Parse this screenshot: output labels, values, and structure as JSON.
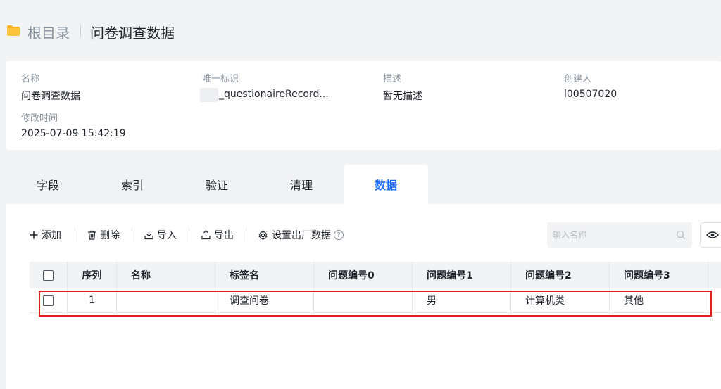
{
  "breadcrumb": {
    "root": "根目录",
    "current": "问卷调查数据",
    "folder_icon": "folder-icon"
  },
  "info": {
    "name_label": "名称",
    "name_value": "问卷调查数据",
    "id_label": "唯一标识",
    "id_value": "_questionaireRecord...",
    "desc_label": "描述",
    "desc_value": "暂无描述",
    "creator_label": "创建人",
    "creator_value": "l00507020",
    "modified_label": "修改时间",
    "modified_value": "2025-07-09 15:42:19"
  },
  "tabs": [
    {
      "label": "字段",
      "active": false
    },
    {
      "label": "索引",
      "active": false
    },
    {
      "label": "验证",
      "active": false
    },
    {
      "label": "清理",
      "active": false
    },
    {
      "label": "数据",
      "active": true
    }
  ],
  "toolbar": {
    "add": "添加",
    "delete": "删除",
    "import": "导入",
    "export": "导出",
    "factory_settings": "设置出厂数据",
    "search_placeholder": "输入名称"
  },
  "table": {
    "headers": [
      "序列",
      "名称",
      "标签名",
      "问题编号0",
      "问题编号1",
      "问题编号2",
      "问题编号3"
    ],
    "rows": [
      [
        "1",
        "",
        "调查问卷",
        "",
        "男",
        "计算机类",
        "其他"
      ]
    ]
  },
  "colors": {
    "accent": "#1e6fff",
    "highlight": "#e02020"
  }
}
